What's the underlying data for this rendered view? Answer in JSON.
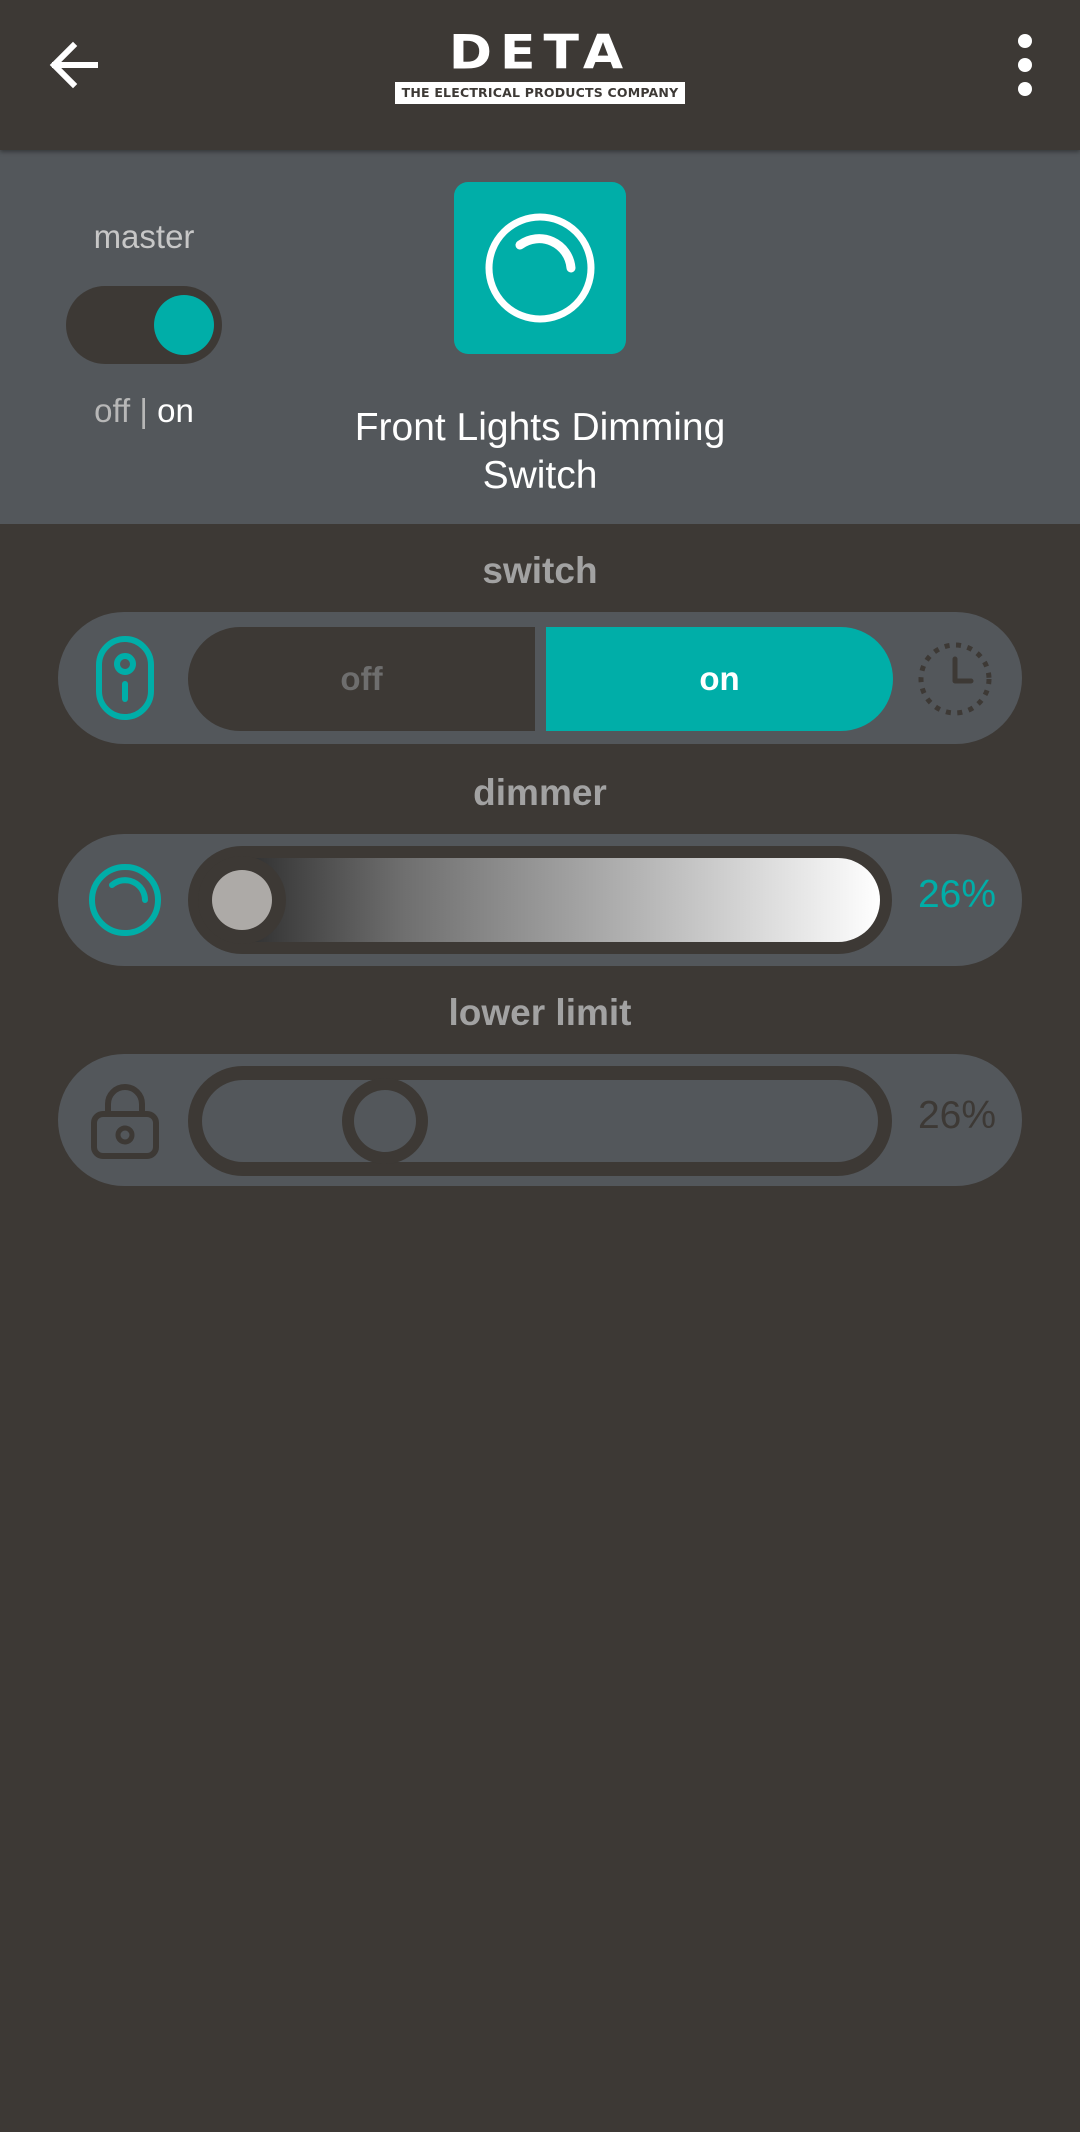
{
  "app": {
    "brand": "DETA",
    "brand_tagline": "THE ELECTRICAL PRODUCTS COMPANY"
  },
  "topbar": {
    "back_icon": "arrow-left-icon",
    "menu_icon": "more-vertical-icon"
  },
  "device": {
    "master_label": "master",
    "master_off": "off",
    "master_separator": "|",
    "master_on": "on",
    "master_state": "on",
    "title": "Front Lights Dimming Switch",
    "icon": "dimmer-dial-icon"
  },
  "switch": {
    "label": "switch",
    "off_label": "off",
    "on_label": "on",
    "selected": "on",
    "icon": "wall-switch-icon",
    "timer_icon": "timer-clock-icon"
  },
  "dimmer": {
    "label": "dimmer",
    "value": "26%",
    "level": 0.26,
    "icon": "dimmer-dial-icon"
  },
  "lower_limit": {
    "label": "lower limit",
    "value": "26%",
    "level": 0.26,
    "icon": "padlock-icon"
  },
  "colors": {
    "background": "#3d3935",
    "panel": "#53575b",
    "accent": "#00aea8",
    "text": "#ffffff",
    "muted": "#a2a2a2"
  }
}
